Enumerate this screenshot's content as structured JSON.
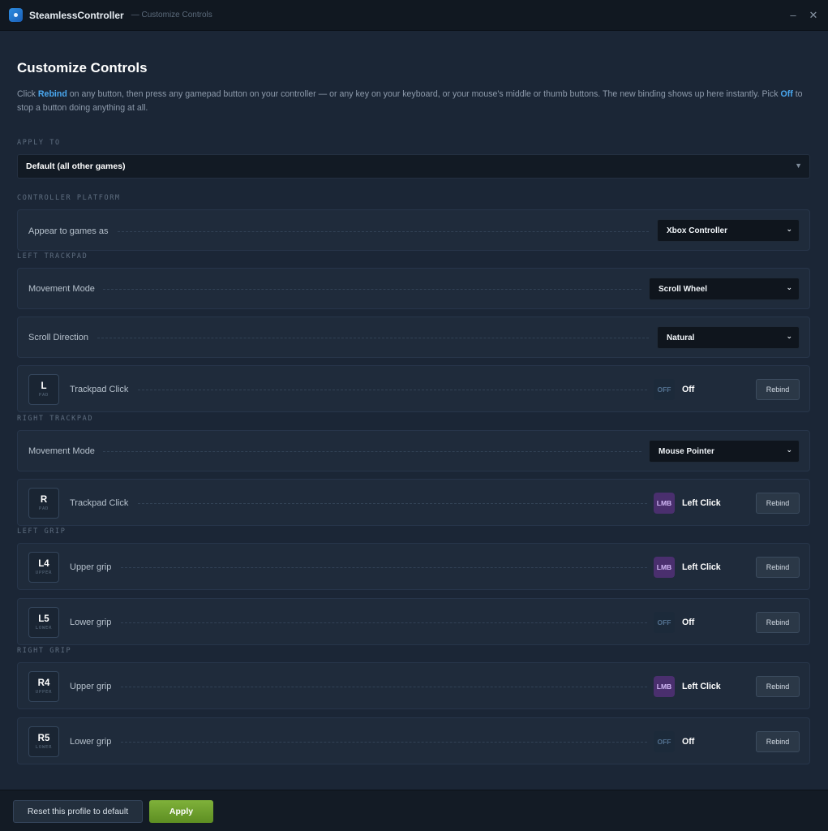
{
  "titlebar": {
    "app_name": "SteamlessController",
    "subtitle": "— Customize Controls",
    "minimize": "–",
    "close": "✕"
  },
  "page": {
    "title": "Customize Controls",
    "intro_1": "Click ",
    "intro_rebind": "Rebind",
    "intro_2": " on any button, then press any gamepad button on your controller — or any key on your keyboard, or your mouse's middle or thumb buttons. The new binding shows up here instantly. Pick ",
    "intro_off": "Off",
    "intro_3": " to stop a button doing anything at all."
  },
  "apply_to": {
    "label": "APPLY TO",
    "selected": "Default (all other games)"
  },
  "platform": {
    "label": "CONTROLLER PLATFORM",
    "row_label": "Appear to games as",
    "selected": "Xbox Controller"
  },
  "left_trackpad": {
    "label": "LEFT TRACKPAD",
    "movement_label": "Movement Mode",
    "movement_value": "Scroll Wheel",
    "scroll_label": "Scroll Direction",
    "scroll_value": "Natural",
    "click": {
      "key": "L",
      "sub": "PAD",
      "name": "Trackpad Click",
      "chip": "OFF",
      "binding": "Off",
      "rebind": "Rebind"
    }
  },
  "right_trackpad": {
    "label": "RIGHT TRACKPAD",
    "movement_label": "Movement Mode",
    "movement_value": "Mouse Pointer",
    "click": {
      "key": "R",
      "sub": "PAD",
      "name": "Trackpad Click",
      "chip": "LMB",
      "binding": "Left Click",
      "rebind": "Rebind"
    }
  },
  "left_grip": {
    "label": "LEFT GRIP",
    "upper": {
      "key": "L4",
      "sub": "UPPER",
      "name": "Upper grip",
      "chip": "LMB",
      "binding": "Left Click",
      "rebind": "Rebind"
    },
    "lower": {
      "key": "L5",
      "sub": "LOWER",
      "name": "Lower grip",
      "chip": "OFF",
      "binding": "Off",
      "rebind": "Rebind"
    }
  },
  "right_grip": {
    "label": "RIGHT GRIP",
    "upper": {
      "key": "R4",
      "sub": "UPPER",
      "name": "Upper grip",
      "chip": "LMB",
      "binding": "Left Click",
      "rebind": "Rebind"
    },
    "lower": {
      "key": "R5",
      "sub": "LOWER",
      "name": "Lower grip",
      "chip": "OFF",
      "binding": "Off",
      "rebind": "Rebind"
    }
  },
  "footer": {
    "reset": "Reset this profile to default",
    "apply": "Apply"
  },
  "colors": {
    "accent": "#4aa8f0",
    "apply_green": "#6fa02e",
    "lmb_chip": "#4a2f6e"
  }
}
